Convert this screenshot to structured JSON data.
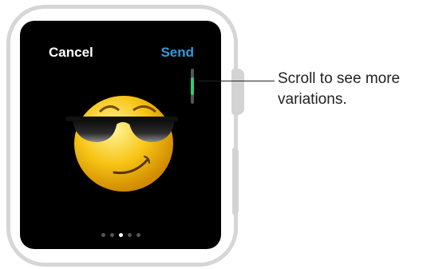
{
  "watch": {
    "cancel_label": "Cancel",
    "send_label": "Send",
    "emoji_icon": "sunglasses-smirk-emoji",
    "scroll_position": 0.5,
    "page_dots": {
      "count": 5,
      "active_index": 2
    }
  },
  "callout": {
    "text": "Scroll to see more variations."
  },
  "colors": {
    "send": "#2d9cdb",
    "scroll_thumb": "#2ecc71",
    "screen": "#000000"
  }
}
